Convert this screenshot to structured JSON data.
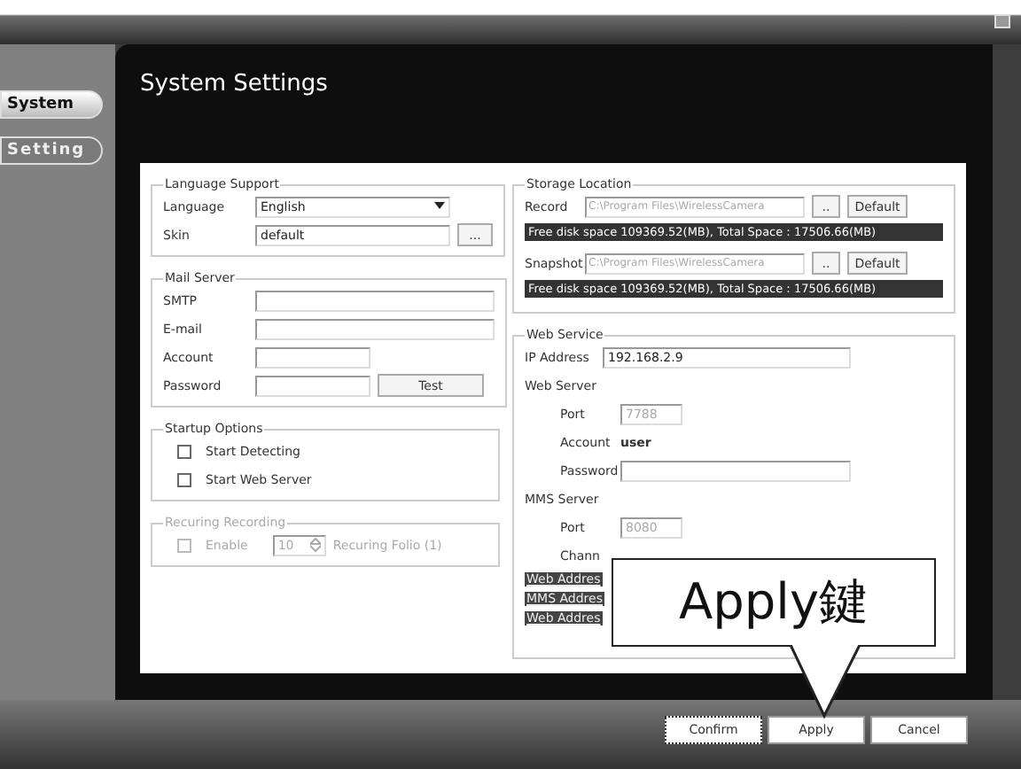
{
  "sidebar": {
    "items": [
      {
        "label": "System",
        "selected": true
      },
      {
        "label": "Setting",
        "selected": false
      }
    ]
  },
  "title": "System Settings",
  "language_support": {
    "title": "Language Support",
    "language_label": "Language",
    "language_value": "English",
    "skin_label": "Skin",
    "skin_value": "default",
    "browse": "..."
  },
  "mail_server": {
    "title": "Mail Server",
    "fields": [
      {
        "label": "SMTP"
      },
      {
        "label": "E-mail"
      },
      {
        "label": "Account"
      },
      {
        "label": "Password"
      }
    ],
    "test_button": "Test"
  },
  "startup_options": {
    "title": "Startup Options",
    "options": [
      {
        "label": "Start Detecting",
        "checked": false
      },
      {
        "label": "Start Web Server",
        "checked": false
      }
    ]
  },
  "recuring_recording": {
    "title": "Recuring Recording",
    "disabled": true,
    "enable_label": "Enable",
    "enable_checked": false,
    "count": "10",
    "suffix": "Recuring Folio (1)"
  },
  "storage_location": {
    "title": "Storage Location",
    "rows": [
      {
        "label": "Record",
        "path": "C:\\Program Files\\WirelessCamera",
        "browse": "..",
        "default": "Default",
        "space": "Free disk space 109369.52(MB), Total Space : 17506.66(MB)"
      },
      {
        "label": "Snapshot",
        "path": "C:\\Program Files\\WirelessCamera",
        "browse": "..",
        "default": "Default",
        "space": "Free disk space 109369.52(MB), Total Space : 17506.66(MB)"
      }
    ]
  },
  "web_service": {
    "title": "Web Service",
    "ip_label": "IP Address",
    "ip_value": "192.168.2.9",
    "web_server": "Web Server",
    "web_port_label": "Port",
    "web_port": "7788",
    "account_label": "Account",
    "account_value": "user",
    "password_label": "Password",
    "mms_server": "MMS Server",
    "mms_port_label": "Port",
    "mms_port": "8080",
    "channel_label": "Chann",
    "addresses": [
      "Web Addres",
      "MMS Addres",
      "Web Addres"
    ]
  },
  "buttons": [
    {
      "label": "Confirm",
      "focused": true
    },
    {
      "label": "Apply",
      "focused": false
    },
    {
      "label": "Cancel",
      "focused": false
    }
  ],
  "callout": {
    "text": "Apply鍵"
  }
}
